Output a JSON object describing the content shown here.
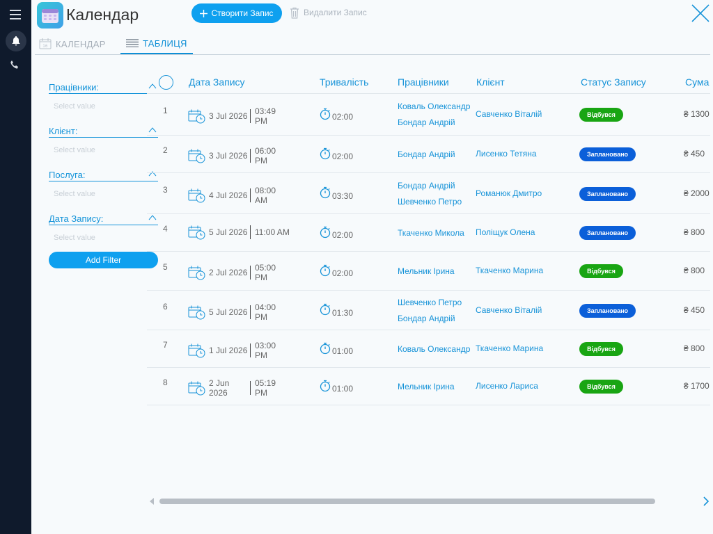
{
  "app": {
    "title": "Календар"
  },
  "toolbar": {
    "create_label": "Створити Запис",
    "delete_label": "Видалити Запис"
  },
  "tabs": [
    {
      "label": "КАЛЕНДАР",
      "icon": "calendar-icon",
      "active": false
    },
    {
      "label": "ТАБЛИЦЯ",
      "icon": "table-icon",
      "active": true
    }
  ],
  "filters": {
    "groups": [
      {
        "label": "Працівники:",
        "placeholder": "Select value"
      },
      {
        "label": "Клієнт:",
        "placeholder": "Select value"
      },
      {
        "label": "Послуга:",
        "placeholder": "Select value"
      },
      {
        "label": "Дата Запису:",
        "placeholder": "Select value"
      }
    ],
    "add_label": "Add Filter"
  },
  "table": {
    "headers": {
      "date": "Дата Запису",
      "duration": "Тривалість",
      "workers": "Працівники",
      "client": "Клієнт",
      "status": "Статус Запису",
      "sum": "Сума"
    },
    "rows": [
      {
        "num": "1",
        "date": "3 Jul 2026",
        "time": "03:49 PM",
        "duration": "02:00",
        "workers": [
          "Коваль Олександр",
          "Бондар Андрій"
        ],
        "client": "Савченко Віталій",
        "status": "Відбувся",
        "status_type": "done",
        "sum": "₴ 1300"
      },
      {
        "num": "2",
        "date": "3 Jul 2026",
        "time": "06:00 PM",
        "duration": "02:00",
        "workers": [
          "Бондар Андрій"
        ],
        "client": "Лисенко Тетяна",
        "status": "Заплановано",
        "status_type": "plan",
        "sum": "₴ 450"
      },
      {
        "num": "3",
        "date": "4 Jul 2026",
        "time": "08:00 AM",
        "duration": "03:30",
        "workers": [
          "Бондар Андрій",
          "Шевченко Петро"
        ],
        "client": "Романюк Дмитро",
        "status": "Заплановано",
        "status_type": "plan",
        "sum": "₴ 2000"
      },
      {
        "num": "4",
        "date": "5 Jul 2026",
        "time": "11:00 AM",
        "duration": "02:00",
        "workers": [
          "Ткаченко Микола"
        ],
        "client": "Поліщук Олена",
        "status": "Заплановано",
        "status_type": "plan",
        "sum": "₴ 800"
      },
      {
        "num": "5",
        "date": "2 Jul 2026",
        "time": "05:00 PM",
        "duration": "02:00",
        "workers": [
          "Мельник Ірина"
        ],
        "client": "Ткаченко Марина",
        "status": "Відбувся",
        "status_type": "done",
        "sum": "₴ 800"
      },
      {
        "num": "6",
        "date": "5 Jul 2026",
        "time": "04:00 PM",
        "duration": "01:30",
        "workers": [
          "Шевченко Петро",
          "Бондар Андрій"
        ],
        "client": "Савченко Віталій",
        "status": "Заплановано",
        "status_type": "plan",
        "sum": "₴ 450"
      },
      {
        "num": "7",
        "date": "1 Jul 2026",
        "time": "03:00 PM",
        "duration": "01:00",
        "workers": [
          "Коваль Олександр"
        ],
        "client": "Ткаченко Марина",
        "status": "Відбувся",
        "status_type": "done",
        "sum": "₴ 800"
      },
      {
        "num": "8",
        "date": "2 Jun 2026",
        "time": "05:19 PM",
        "duration": "01:00",
        "workers": [
          "Мельник Ірина"
        ],
        "client": "Лисенко Лариса",
        "status": "Відбувся",
        "status_type": "done",
        "sum": "₴ 1700"
      }
    ]
  }
}
